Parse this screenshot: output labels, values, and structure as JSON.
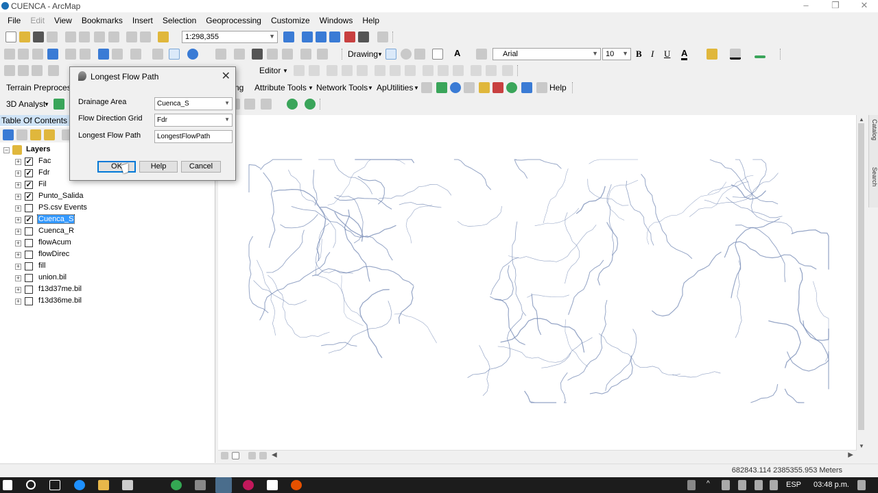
{
  "window": {
    "title": "CUENCA - ArcMap"
  },
  "menu": [
    "File",
    "Edit",
    "View",
    "Bookmarks",
    "Insert",
    "Selection",
    "Geoprocessing",
    "Customize",
    "Windows",
    "Help"
  ],
  "toolbar": {
    "scale": "1:298,355",
    "drawing_label": "Drawing",
    "font_name": "Arial",
    "font_size": "10",
    "bold": "B",
    "italic": "I",
    "underline": "U",
    "editor_label": "Editor",
    "terrain_label": "Terrain Preprocessi",
    "analyst_label": "3D Analyst",
    "apfrag": "ng",
    "attribute_tools": "Attribute Tools",
    "network_tools": "Network Tools",
    "aputilities": "ApUtilities",
    "help": "Help"
  },
  "toc": {
    "title": "Table Of Contents",
    "root": "Layers",
    "layers": [
      {
        "name": "Fac",
        "checked": true,
        "selected": false
      },
      {
        "name": "Fdr",
        "checked": true,
        "selected": false
      },
      {
        "name": "Fil",
        "checked": true,
        "selected": false
      },
      {
        "name": "Punto_Salida",
        "checked": true,
        "selected": false
      },
      {
        "name": "PS.csv Events",
        "checked": false,
        "selected": false
      },
      {
        "name": "Cuenca_S",
        "checked": true,
        "selected": true
      },
      {
        "name": "Cuenca_R",
        "checked": false,
        "selected": false
      },
      {
        "name": "flowAcum",
        "checked": false,
        "selected": false
      },
      {
        "name": "flowDirec",
        "checked": false,
        "selected": false
      },
      {
        "name": "fill",
        "checked": false,
        "selected": false
      },
      {
        "name": "union.bil",
        "checked": false,
        "selected": false
      },
      {
        "name": "f13d37me.bil",
        "checked": false,
        "selected": false
      },
      {
        "name": "f13d36me.bil",
        "checked": false,
        "selected": false
      }
    ]
  },
  "dialog": {
    "title": "Longest Flow Path",
    "fields": [
      {
        "label": "Drainage Area",
        "value": "Cuenca_S",
        "dropdown": true
      },
      {
        "label": "Flow Direction Grid",
        "value": "Fdr",
        "dropdown": true
      },
      {
        "label": "Longest Flow Path",
        "value": "LongestFlowPath",
        "dropdown": false
      }
    ],
    "ok": "OK",
    "help": "Help",
    "cancel": "Cancel"
  },
  "side_tabs": [
    "Catalog",
    "Search"
  ],
  "status": {
    "coordinates": "682843.114  2385355.953 Meters"
  },
  "taskbar": {
    "language": "ESP",
    "time": "03:48 p.m."
  },
  "colors": {
    "selection": "#3399ff",
    "streams": "#7a8fb8",
    "taskbar": "#1c1c1c"
  }
}
